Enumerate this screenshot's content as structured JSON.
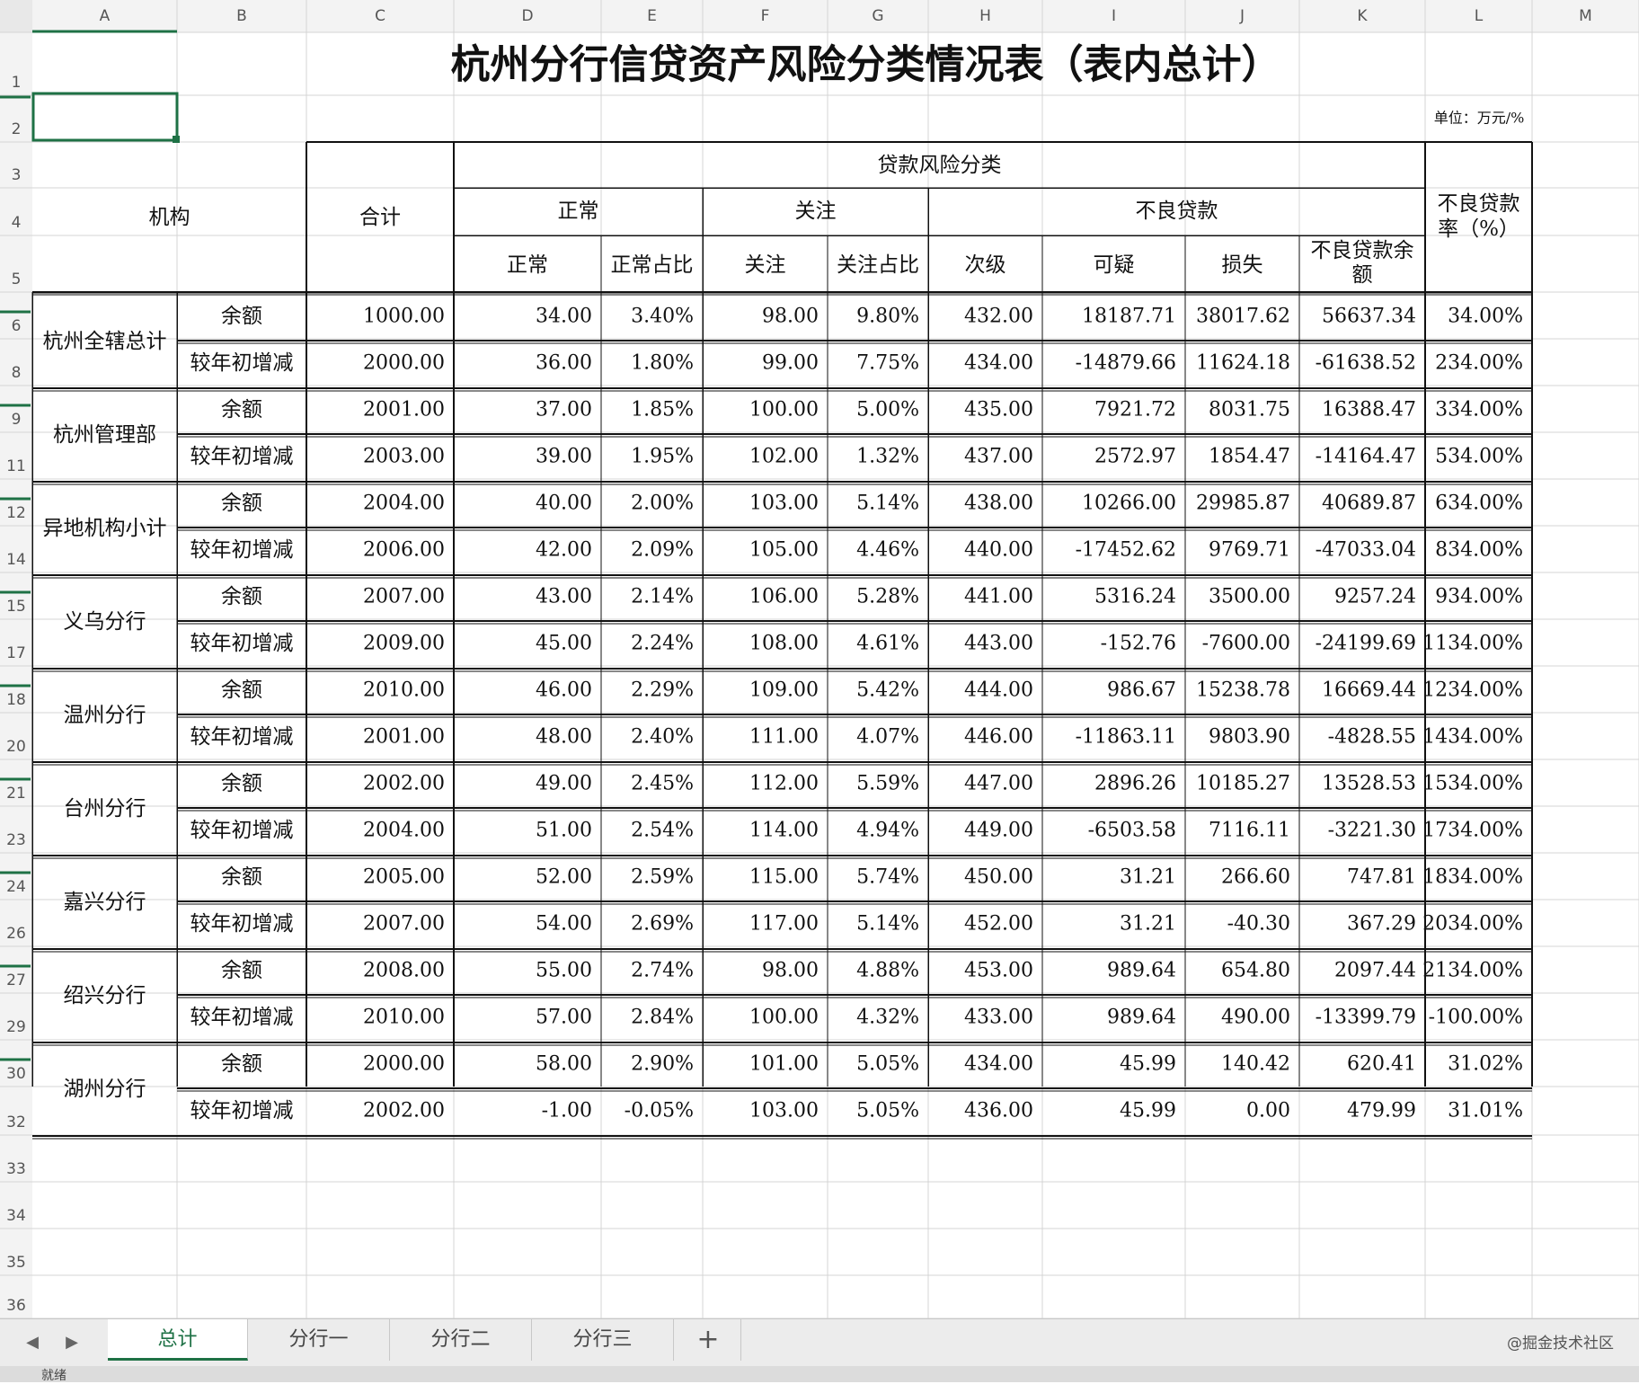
{
  "columns": [
    "A",
    "B",
    "C",
    "D",
    "E",
    "F",
    "G",
    "H",
    "I",
    "J",
    "K",
    "L",
    "M"
  ],
  "row_numbers": [
    "1",
    "2",
    "3",
    "4",
    "5",
    "6",
    "8",
    "9",
    "11",
    "12",
    "14",
    "15",
    "17",
    "18",
    "20",
    "21",
    "23",
    "24",
    "26",
    "27",
    "29",
    "30",
    "32",
    "33",
    "34",
    "35",
    "36"
  ],
  "title": "杭州分行信贷资产风险分类情况表（表内总计）",
  "unit": "单位：万元/%",
  "header": {
    "org": "机构",
    "total": "合计",
    "loan_risk": "贷款风险分类",
    "normal_group": "正常",
    "attention_group": "关注",
    "npl_group": "不良贷款",
    "npl_rate": [
      "不良贷款",
      "率（%）"
    ],
    "sub": [
      "正常",
      "正常占比",
      "关注",
      "关注占比",
      "次级",
      "可疑",
      "损失"
    ],
    "npl_balance": [
      "不良贷款余",
      "额"
    ]
  },
  "row_types": [
    "余额",
    "较年初增减"
  ],
  "groups": [
    {
      "name": "杭州全辖总计",
      "rows": [
        [
          "1000.00",
          "34.00",
          "3.40%",
          "98.00",
          "9.80%",
          "432.00",
          "18187.71",
          "38017.62",
          "56637.34",
          "34.00%"
        ],
        [
          "2000.00",
          "36.00",
          "1.80%",
          "99.00",
          "7.75%",
          "434.00",
          "-14879.66",
          "11624.18",
          "-61638.52",
          "234.00%"
        ]
      ]
    },
    {
      "name": "杭州管理部",
      "rows": [
        [
          "2001.00",
          "37.00",
          "1.85%",
          "100.00",
          "5.00%",
          "435.00",
          "7921.72",
          "8031.75",
          "16388.47",
          "334.00%"
        ],
        [
          "2003.00",
          "39.00",
          "1.95%",
          "102.00",
          "1.32%",
          "437.00",
          "2572.97",
          "1854.47",
          "-14164.47",
          "534.00%"
        ]
      ]
    },
    {
      "name": "异地机构小计",
      "rows": [
        [
          "2004.00",
          "40.00",
          "2.00%",
          "103.00",
          "5.14%",
          "438.00",
          "10266.00",
          "29985.87",
          "40689.87",
          "634.00%"
        ],
        [
          "2006.00",
          "42.00",
          "2.09%",
          "105.00",
          "4.46%",
          "440.00",
          "-17452.62",
          "9769.71",
          "-47033.04",
          "834.00%"
        ]
      ]
    },
    {
      "name": "义乌分行",
      "rows": [
        [
          "2007.00",
          "43.00",
          "2.14%",
          "106.00",
          "5.28%",
          "441.00",
          "5316.24",
          "3500.00",
          "9257.24",
          "934.00%"
        ],
        [
          "2009.00",
          "45.00",
          "2.24%",
          "108.00",
          "4.61%",
          "443.00",
          "-152.76",
          "-7600.00",
          "-24199.69",
          "1134.00%"
        ]
      ]
    },
    {
      "name": "温州分行",
      "rows": [
        [
          "2010.00",
          "46.00",
          "2.29%",
          "109.00",
          "5.42%",
          "444.00",
          "986.67",
          "15238.78",
          "16669.44",
          "1234.00%"
        ],
        [
          "2001.00",
          "48.00",
          "2.40%",
          "111.00",
          "4.07%",
          "446.00",
          "-11863.11",
          "9803.90",
          "-4828.55",
          "1434.00%"
        ]
      ]
    },
    {
      "name": "台州分行",
      "rows": [
        [
          "2002.00",
          "49.00",
          "2.45%",
          "112.00",
          "5.59%",
          "447.00",
          "2896.26",
          "10185.27",
          "13528.53",
          "1534.00%"
        ],
        [
          "2004.00",
          "51.00",
          "2.54%",
          "114.00",
          "4.94%",
          "449.00",
          "-6503.58",
          "7116.11",
          "-3221.30",
          "1734.00%"
        ]
      ]
    },
    {
      "name": "嘉兴分行",
      "rows": [
        [
          "2005.00",
          "52.00",
          "2.59%",
          "115.00",
          "5.74%",
          "450.00",
          "31.21",
          "266.60",
          "747.81",
          "1834.00%"
        ],
        [
          "2007.00",
          "54.00",
          "2.69%",
          "117.00",
          "5.14%",
          "452.00",
          "31.21",
          "-40.30",
          "367.29",
          "2034.00%"
        ]
      ]
    },
    {
      "name": "绍兴分行",
      "rows": [
        [
          "2008.00",
          "55.00",
          "2.74%",
          "98.00",
          "4.88%",
          "453.00",
          "989.64",
          "654.80",
          "2097.44",
          "2134.00%"
        ],
        [
          "2010.00",
          "57.00",
          "2.84%",
          "100.00",
          "4.32%",
          "433.00",
          "989.64",
          "490.00",
          "-13399.79",
          "-100.00%"
        ]
      ]
    },
    {
      "name": "湖州分行",
      "rows": [
        [
          "2000.00",
          "58.00",
          "2.90%",
          "101.00",
          "5.05%",
          "434.00",
          "45.99",
          "140.42",
          "620.41",
          "31.02%"
        ],
        [
          "2002.00",
          "-1.00",
          "-0.05%",
          "103.00",
          "5.05%",
          "436.00",
          "45.99",
          "0.00",
          "479.99",
          "31.01%"
        ]
      ]
    }
  ],
  "tabs": [
    {
      "label": "总计",
      "active": true
    },
    {
      "label": "分行一",
      "active": false
    },
    {
      "label": "分行二",
      "active": false
    },
    {
      "label": "分行三",
      "active": false
    }
  ],
  "add_tab_label": "+",
  "watermark": "@掘金技术社区",
  "status_text": "就绪",
  "colors": {
    "accent": "#1e7145",
    "header_bg": "#f3f3f3",
    "grid": "#d4d4d4"
  }
}
